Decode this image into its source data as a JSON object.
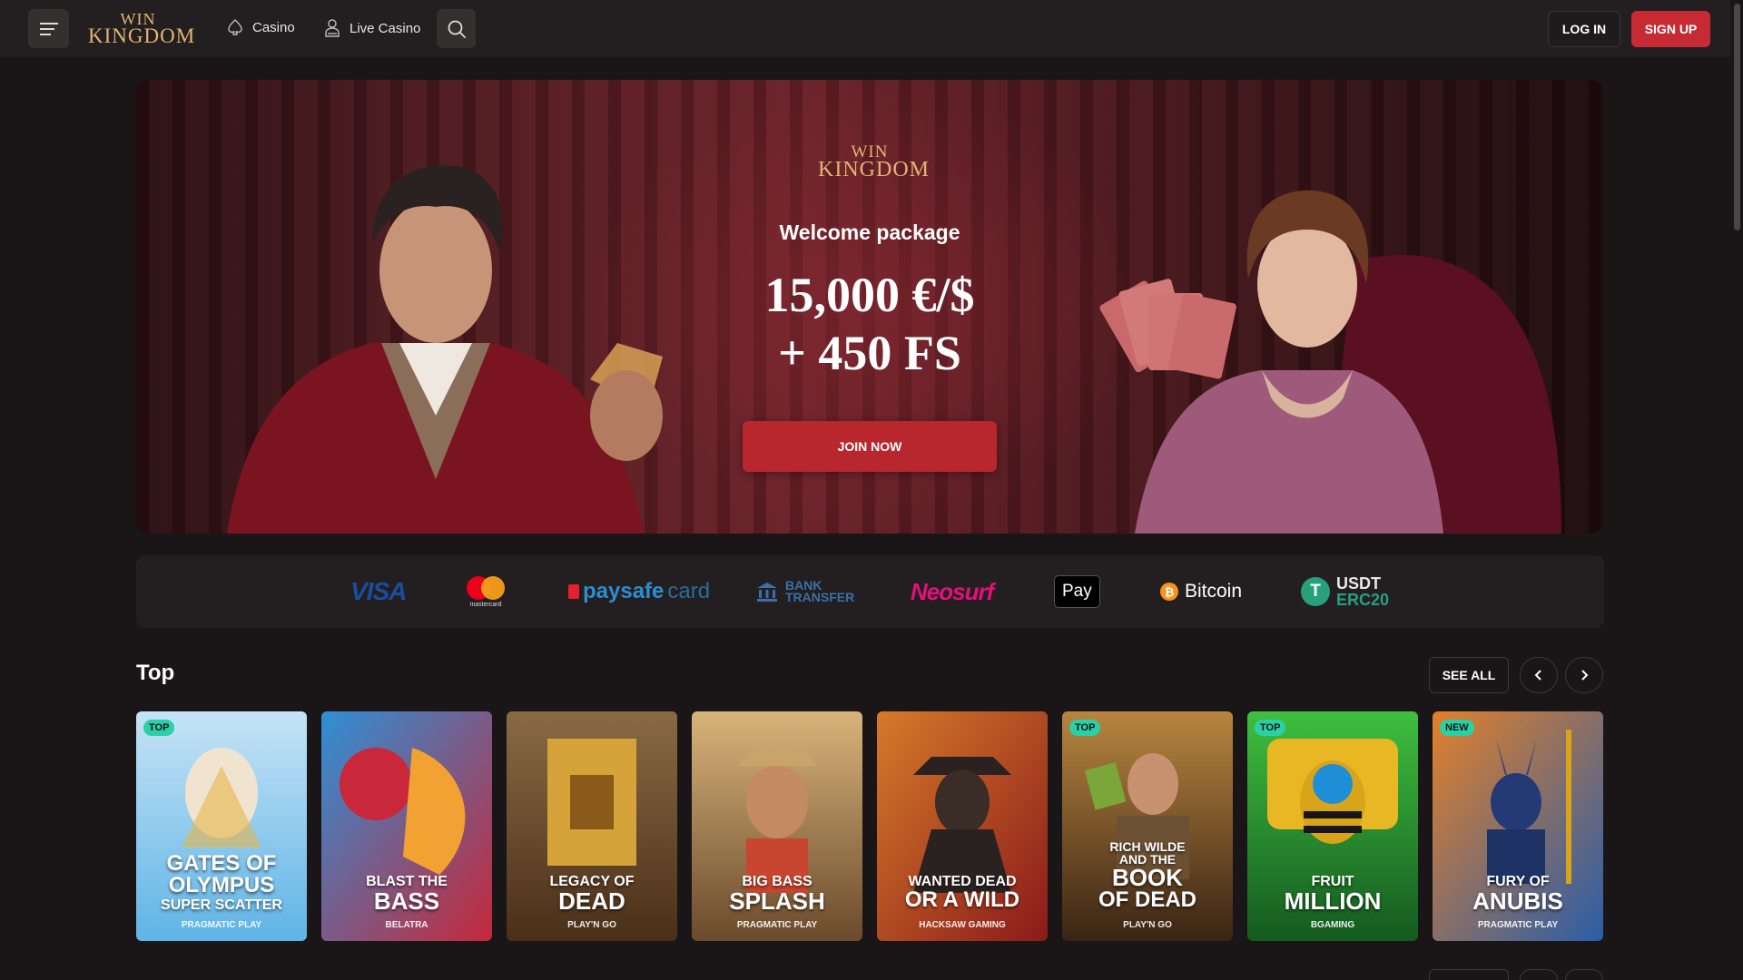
{
  "header": {
    "logo_line1": "WIN",
    "logo_line2": "KINGDOM",
    "nav": [
      {
        "label": "Casino",
        "icon": "spade-icon"
      },
      {
        "label": "Live Casino",
        "icon": "dealer-icon"
      }
    ],
    "login_label": "LOG IN",
    "signup_label": "SIGN UP"
  },
  "hero": {
    "logo_line1": "WIN",
    "logo_line2": "KINGDOM",
    "subtitle": "Welcome package",
    "amount_line1": "15,000 €/$",
    "amount_line2": "+ 450 FS",
    "cta_label": "JOIN NOW"
  },
  "payments": {
    "visa": "VISA",
    "mastercard": "mastercard",
    "paysafecard_a": "paysafe",
    "paysafecard_b": "card",
    "bank_line1": "BANK",
    "bank_line2": "TRANSFER",
    "neosurf": "Neosurf",
    "applepay": "Pay",
    "bitcoin": "Bitcoin",
    "bitcoin_symbol": "₿",
    "usdt_line1": "USDT",
    "usdt_line2": "ERC20",
    "usdt_symbol": "T"
  },
  "section": {
    "title": "Top",
    "see_all_label": "SEE ALL"
  },
  "games": [
    {
      "badge": "TOP",
      "line1": "GATES OF",
      "line2": "OLYMPUS",
      "line3": "SUPER SCATTER",
      "provider": "PRAGMATIC PLAY",
      "bg1": "#5fb4e6",
      "bg2": "#c6e3f6"
    },
    {
      "badge": "",
      "line1": "BLAST THE",
      "line2": "BASS",
      "line3": "",
      "provider": "BELATRA",
      "bg1": "#c6283a",
      "bg2": "#2e8fd6"
    },
    {
      "badge": "",
      "line1": "LEGACY OF",
      "line2": "DEAD",
      "line3": "",
      "provider": "PLAY'N GO",
      "bg1": "#5a3a1e",
      "bg2": "#c9902a"
    },
    {
      "badge": "",
      "line1": "BIG BASS",
      "line2": "SPLASH",
      "line3": "",
      "provider": "PRAGMATIC PLAY",
      "bg1": "#6b4a2c",
      "bg2": "#d8b47a"
    },
    {
      "badge": "",
      "line1": "WANTED DEAD",
      "line2": "OR A WILD",
      "line3": "",
      "provider": "HACKSAW GAMING",
      "bg1": "#a02020",
      "bg2": "#d67a2a"
    },
    {
      "badge": "TOP",
      "line1": "RICH WILDE AND THE",
      "line2": "BOOK",
      "line3": "OF DEAD",
      "provider": "PLAY'N GO",
      "bg1": "#4a2f1c",
      "bg2": "#b7853f"
    },
    {
      "badge": "TOP",
      "line1": "FRUIT",
      "line2": "MILLION",
      "line3": "",
      "provider": "BGAMING",
      "bg1": "#1c7a2c",
      "bg2": "#3fbf3f"
    },
    {
      "badge": "NEW",
      "line1": "FURY OF",
      "line2": "ANUBIS",
      "line3": "",
      "provider": "PRAGMATIC PLAY",
      "bg1": "#c24c1f",
      "bg2": "#2b5da8"
    }
  ],
  "colors": {
    "accent_red": "#c62b34",
    "gold": "#e2b574",
    "badge_green": "#2ad0a6"
  }
}
